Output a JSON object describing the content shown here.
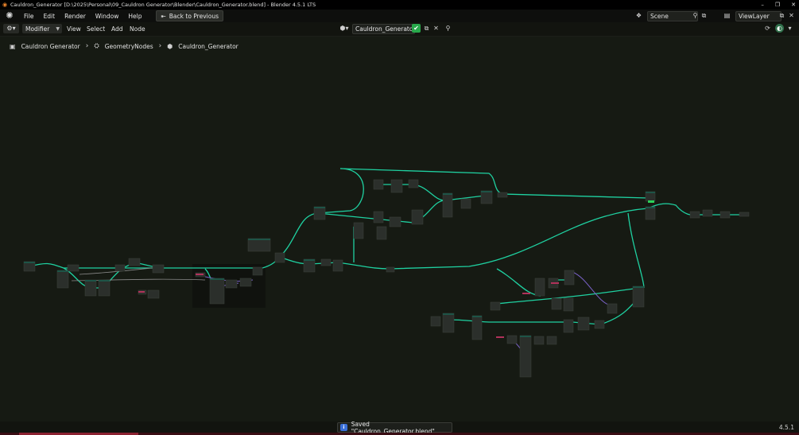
{
  "window": {
    "title": "Cauldron_Generator [D:\\2025\\Personal\\09_Cauldron Generator\\Blender\\Cauldron_Generator.blend] - Blender 4.5.1 LTS",
    "controls": {
      "minimize": "–",
      "restore": "❐",
      "close": "✕"
    }
  },
  "menubar": {
    "items": [
      "File",
      "Edit",
      "Render",
      "Window",
      "Help"
    ],
    "back_button": "Back to Previous",
    "scene": "Scene",
    "view_layer": "ViewLayer"
  },
  "header": {
    "mode": "Modifier",
    "menus": [
      "View",
      "Select",
      "Add",
      "Node"
    ],
    "node_tree": "Cauldron_Generator"
  },
  "breadcrumb": {
    "items": [
      "Cauldron Generator",
      "GeometryNodes",
      "Cauldron_Generator"
    ]
  },
  "status": {
    "message": "Saved \"Cauldron_Generator.blend\"",
    "version": "4.5.1"
  },
  "colors": {
    "wire": "#1fd1a1",
    "wire_purple": "#7a62c8",
    "wire_gray": "#8a8a8a",
    "node_body": "#2b2f2b",
    "node_header": "#1e5447",
    "background": "#161a13",
    "accent_green": "#28a84b"
  },
  "icons": {
    "editor_type": "node-editor-icon",
    "pin": "pin-icon",
    "shield": "fake-user-shield-icon",
    "info": "info-icon"
  }
}
